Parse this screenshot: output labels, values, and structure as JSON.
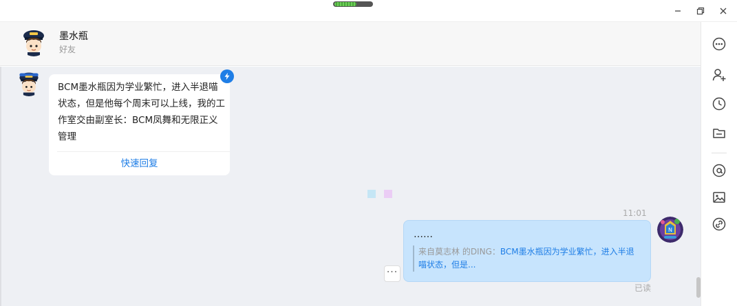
{
  "window": {
    "minimize_icon": "minimize-icon",
    "restore_icon": "restore-icon",
    "close_icon": "close-icon"
  },
  "header": {
    "name": "墨水瓶",
    "subtitle": "好友",
    "avatar_icon": "captain-avatar"
  },
  "messages": {
    "incoming": {
      "text": "BCM墨水瓶因为学业繁忙，进入半退喵状态，但是他每个周末可以上线，我的工作室交由副室长：BCM凤舞和无限正义管理",
      "action": "快速回复",
      "badge_icon": "ding-bolt-icon"
    },
    "outgoing": {
      "time": "11:01",
      "text": "……",
      "quote_source": "来自莫志林 的DING：",
      "quote_text": "BCM墨水瓶因为学业繁忙，进入半退喵状态，但是...",
      "read_status": "已读",
      "more_label": "···"
    }
  },
  "toolbar": {
    "items": [
      "more-icon",
      "add-contact-icon",
      "history-icon",
      "folder-icon",
      "mention-icon",
      "image-icon",
      "link-icon"
    ]
  },
  "colors": {
    "accent": "#1f7ee6",
    "bubble_outgoing": "#c7e4fd",
    "chat_bg": "#eef0f4"
  }
}
